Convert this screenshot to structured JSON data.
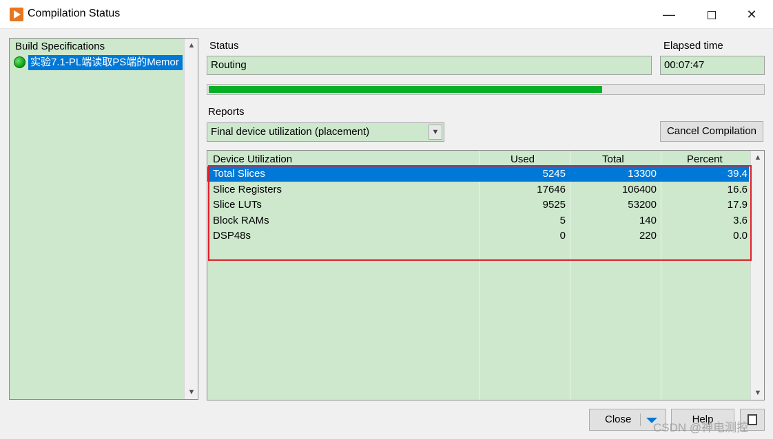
{
  "window": {
    "title": "Compilation Status",
    "controls": {
      "minimize": "—",
      "close": "✕"
    }
  },
  "build_specs": {
    "header": "Build Specifications",
    "items": [
      {
        "label": "实验7.1-PL端读取PS端的Memor",
        "status_color": "#10a010"
      }
    ]
  },
  "status": {
    "label": "Status",
    "value": "Routing"
  },
  "elapsed": {
    "label": "Elapsed time",
    "value": "00:07:47"
  },
  "progress": {
    "fraction": 0.71
  },
  "reports": {
    "label": "Reports",
    "selected": "Final device utilization (placement)"
  },
  "cancel_label": "Cancel Compilation",
  "table": {
    "headers": [
      "Device Utilization",
      "Used",
      "Total",
      "Percent"
    ],
    "rows": [
      {
        "name": "Total Slices",
        "used": "5245",
        "total": "13300",
        "percent": "39.4"
      },
      {
        "name": "Slice Registers",
        "used": "17646",
        "total": "106400",
        "percent": "16.6"
      },
      {
        "name": "Slice LUTs",
        "used": "9525",
        "total": "53200",
        "percent": "17.9"
      },
      {
        "name": "Block RAMs",
        "used": "5",
        "total": "140",
        "percent": "3.6"
      },
      {
        "name": "DSP48s",
        "used": "0",
        "total": "220",
        "percent": "0.0"
      }
    ],
    "selected_index": 0
  },
  "buttons": {
    "close": "Close",
    "help": "Help"
  },
  "watermark": "CSDN @神电测控",
  "colors": {
    "panel_green": "#cde8cd",
    "selection_blue": "#0078d7",
    "progress_green": "#06b025",
    "highlight_red": "#e0202b"
  }
}
